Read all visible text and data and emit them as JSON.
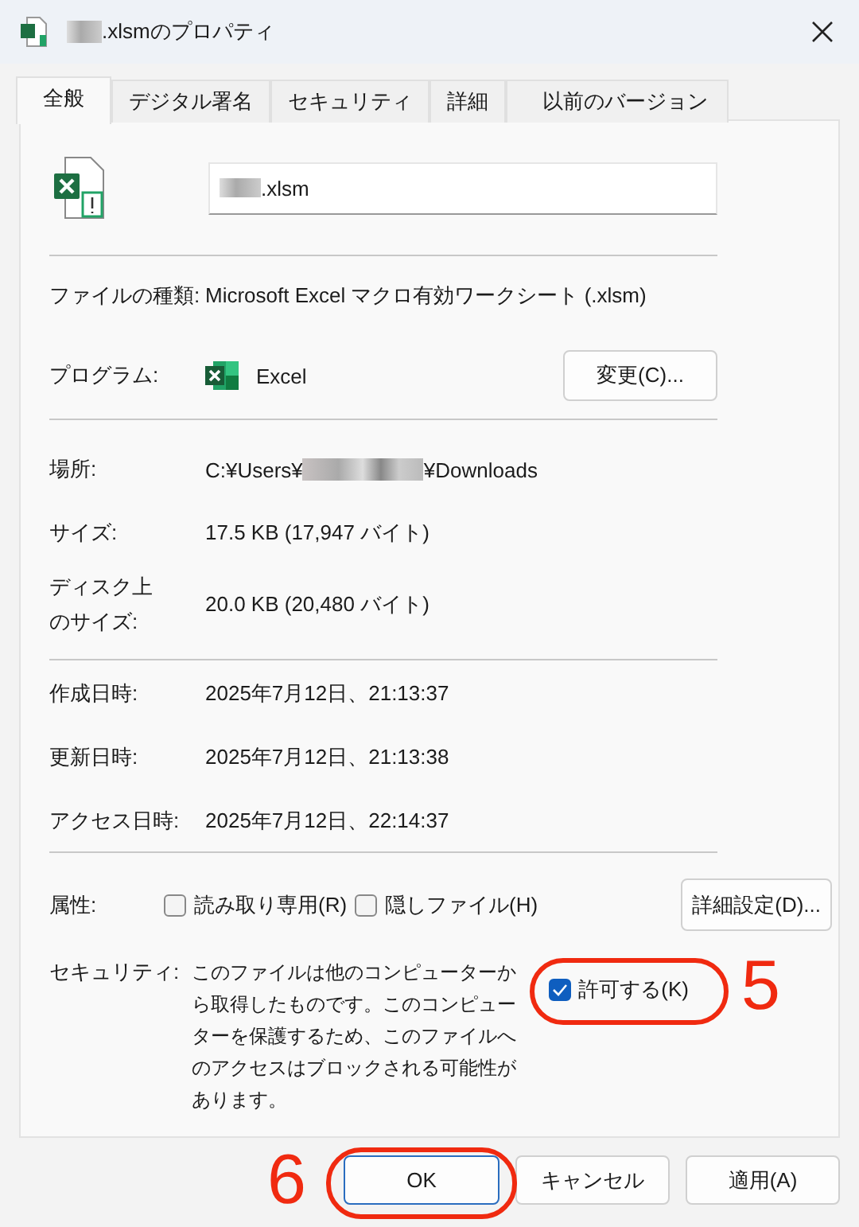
{
  "window": {
    "title": ".xlsmのプロパティ",
    "title_redacted": true
  },
  "tabs": [
    {
      "label": "全般",
      "selected": true
    },
    {
      "label": "デジタル署名",
      "selected": false
    },
    {
      "label": "セキュリティ",
      "selected": false
    },
    {
      "label": "詳細",
      "selected": false
    },
    {
      "label": "以前のバージョン",
      "selected": false
    }
  ],
  "file_name": {
    "value": ".xlsm",
    "redacted": true
  },
  "file_type": {
    "label": "ファイルの種類:",
    "value": "Microsoft Excel マクロ有効ワークシート (.xlsm)"
  },
  "program": {
    "label": "プログラム:",
    "value": "Excel",
    "button": "変更(C)..."
  },
  "location": {
    "label": "場所:",
    "value_parts": [
      "C:¥Users¥",
      "¥Downloads"
    ],
    "redacted": true
  },
  "size": {
    "label": "サイズ:",
    "value": "17.5 KB (17,947 バイト)"
  },
  "disk_size": {
    "label_lines": [
      "ディスク上",
      "のサイズ:"
    ],
    "value": "20.0 KB (20,480 バイト)"
  },
  "dates": [
    {
      "label": "作成日時:",
      "value": "2025年7月12日、21:13:37"
    },
    {
      "label": "更新日時:",
      "value": "2025年7月12日、21:13:38"
    },
    {
      "label": "アクセス日時:",
      "value": "2025年7月12日、22:14:37"
    }
  ],
  "attributes": {
    "label": "属性:",
    "checkboxes": [
      {
        "label": "読み取り専用(R)",
        "checked": false
      },
      {
        "label": "隠しファイル(H)",
        "checked": false
      }
    ],
    "button": "詳細設定(D)..."
  },
  "security": {
    "label": "セキュリティ:",
    "text": "このファイルは他のコンピューターから取得したものです。このコンピューターを保護するため、このファイルへのアクセスはブロックされる可能性があります。",
    "checkbox": {
      "label": "許可する(K)",
      "checked": true
    }
  },
  "buttons": [
    {
      "label": "OK",
      "focused": true
    },
    {
      "label": "キャンセル",
      "focused": false
    },
    {
      "label": "適用(A)",
      "focused": false
    }
  ],
  "annotations": [
    {
      "label": "5",
      "kind": "unblock"
    },
    {
      "label": "6",
      "kind": "ok"
    }
  ]
}
